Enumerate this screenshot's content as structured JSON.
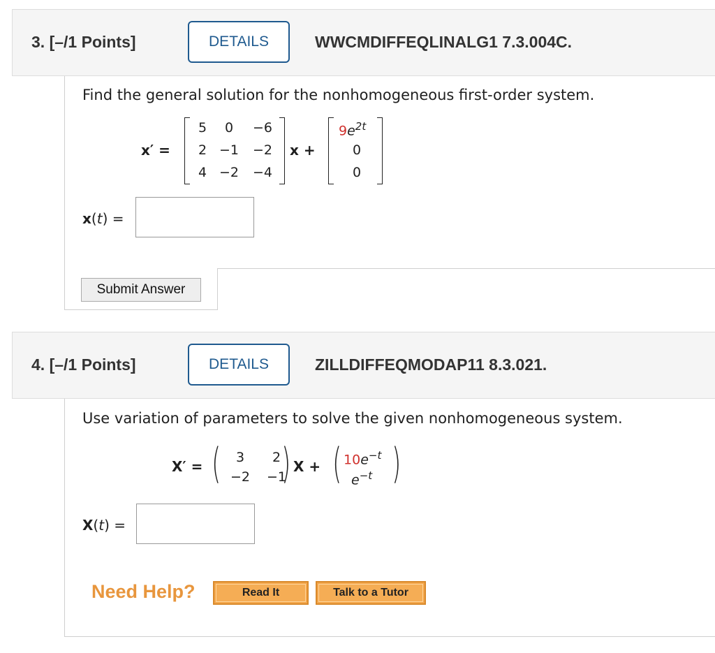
{
  "q3": {
    "number": "3.",
    "points": "[–/1 Points]",
    "details_label": "DETAILS",
    "ref": "WWCMDIFFEQLINALG1 7.3.004C.",
    "prompt": "Find the general solution for the nonhomogeneous first-order system.",
    "lhs": "x′ =",
    "matrix": [
      [
        "5",
        "0",
        "−6"
      ],
      [
        "2",
        "−1",
        "−2"
      ],
      [
        "4",
        "−2",
        "−4"
      ]
    ],
    "x_plus": "x +",
    "forcing": {
      "coef": "9",
      "base": "e",
      "exp": "2t",
      "r2": "0",
      "r3": "0"
    },
    "answer_label_x": "x",
    "answer_label_rest": "(t) =",
    "answer_value": "",
    "submit_label": "Submit Answer"
  },
  "q4": {
    "number": "4.",
    "points": "[–/1 Points]",
    "details_label": "DETAILS",
    "ref": "ZILLDIFFEQMODAP11 8.3.021.",
    "prompt": "Use variation of parameters to solve the given nonhomogeneous system.",
    "lhs": "X′ =",
    "matrix": [
      [
        "3",
        "2"
      ],
      [
        "−2",
        "−1"
      ]
    ],
    "x_plus": "X +",
    "forcing": {
      "r1_coef": "10",
      "r1_base": "e",
      "r1_exp": "−t",
      "r2_base": "e",
      "r2_exp": "−t"
    },
    "answer_label_x": "X",
    "answer_label_rest": "(t) =",
    "answer_value": ""
  },
  "help": {
    "label": "Need Help?",
    "read_label": "Read It",
    "tutor_label": "Talk to a Tutor"
  },
  "colors": {
    "accent": "#1f5a8f",
    "red": "#d0312d",
    "help": "#e8963d"
  }
}
